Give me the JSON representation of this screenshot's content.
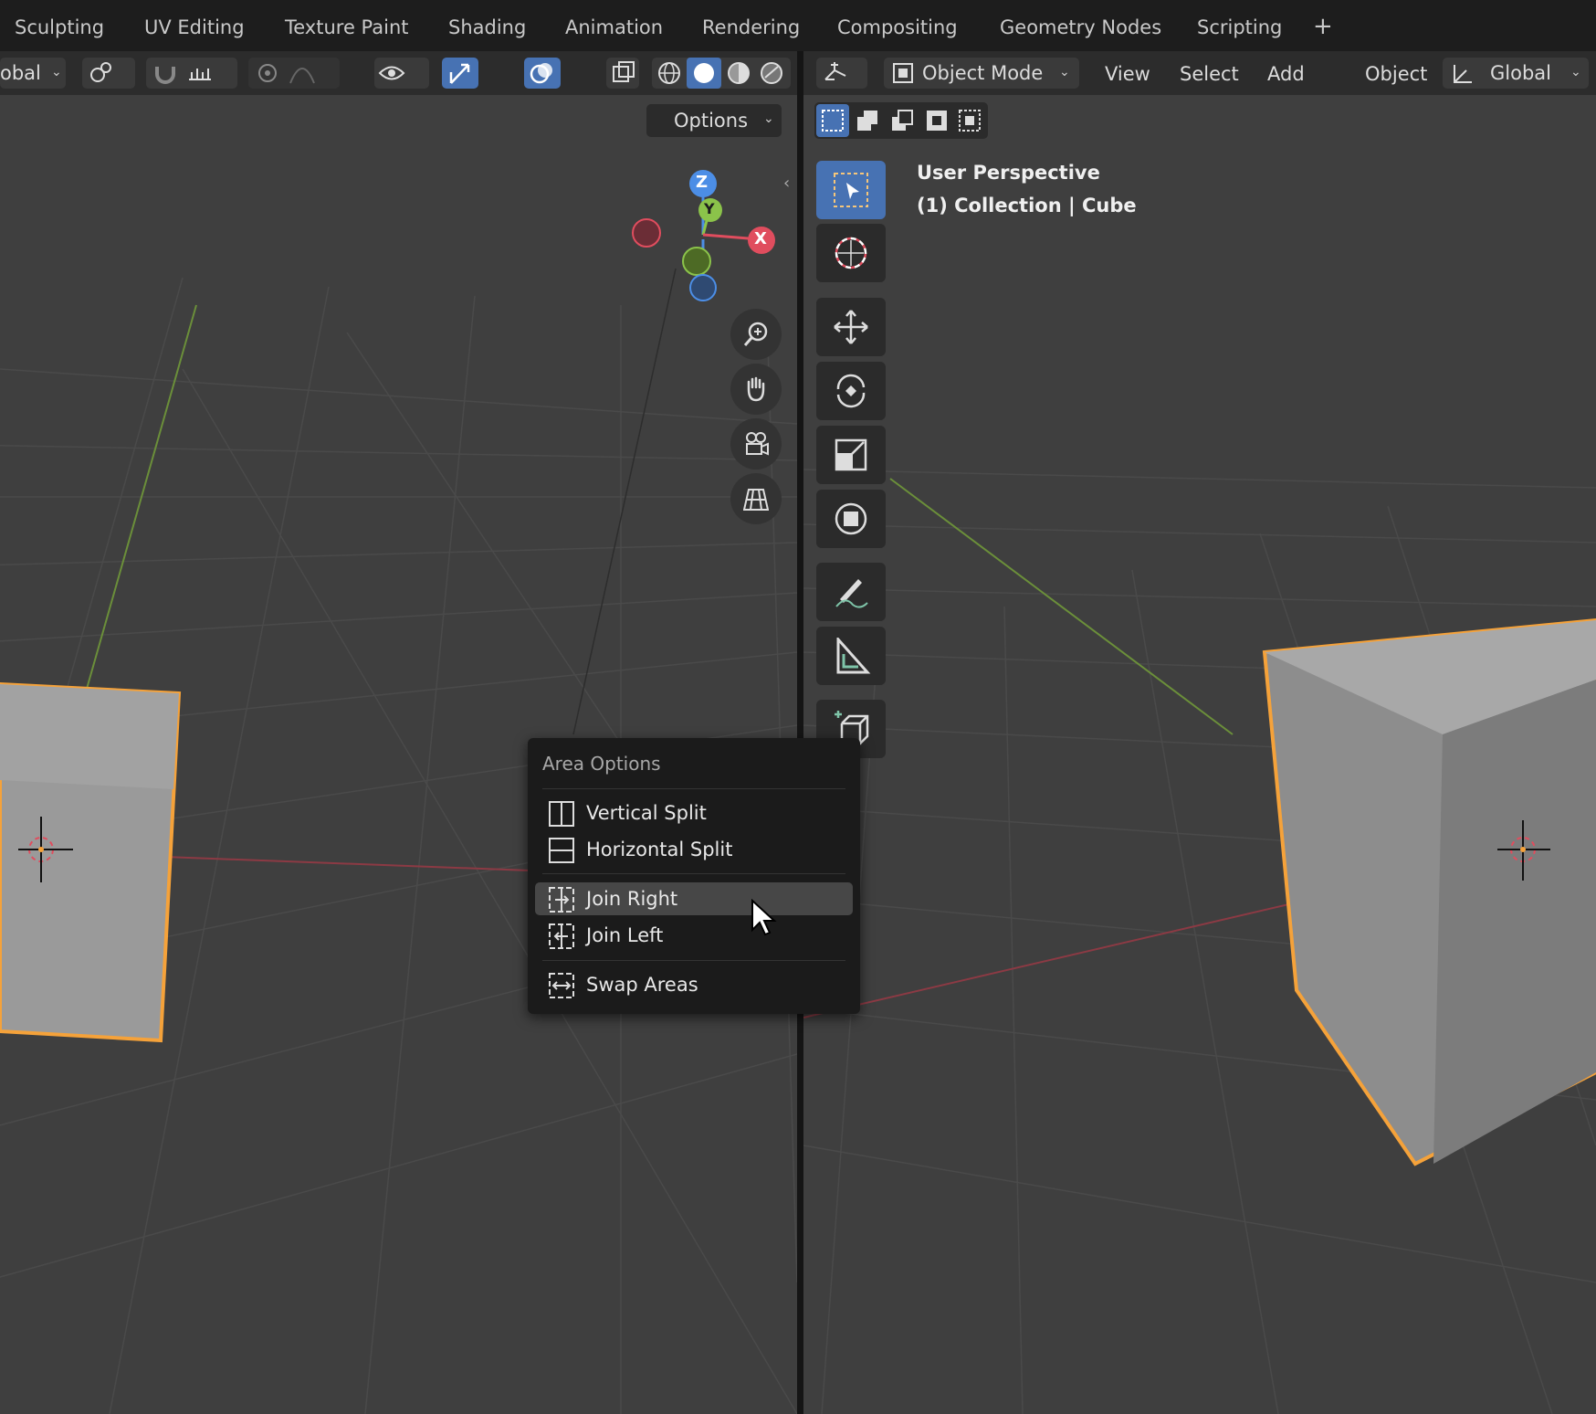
{
  "workspace_tabs": [
    "Sculpting",
    "UV Editing",
    "Texture Paint",
    "Shading",
    "Animation",
    "Rendering",
    "Compositing",
    "Geometry Nodes",
    "Scripting"
  ],
  "add_tab_symbol": "+",
  "left_header": {
    "orientation_partial": "obal",
    "options_label": "Options"
  },
  "right_header": {
    "mode_label": "Object Mode",
    "menus": [
      "View",
      "Select",
      "Add",
      "Object"
    ],
    "orientation_label": "Global"
  },
  "viewport_overlay": {
    "perspective": "User Perspective",
    "collection": "(1) Collection | Cube"
  },
  "gizmo": {
    "z": "Z",
    "y": "Y",
    "x": "X"
  },
  "popup": {
    "title": "Area Options",
    "items": [
      {
        "label": "Vertical Split",
        "icon": "vertical-split-icon"
      },
      {
        "label": "Horizontal Split",
        "icon": "horizontal-split-icon"
      },
      {
        "label": "Join Right",
        "icon": "join-right-icon",
        "highlighted": true
      },
      {
        "label": "Join Left",
        "icon": "join-left-icon"
      },
      {
        "label": "Swap Areas",
        "icon": "swap-areas-icon"
      }
    ]
  },
  "toolbar_tools": [
    "select-box-icon",
    "cursor-icon",
    "move-icon",
    "rotate-icon",
    "scale-icon",
    "transform-icon",
    "annotate-icon",
    "measure-icon",
    "add-cube-icon"
  ],
  "colors": {
    "accent": "#4772b3",
    "selection_outline": "#f5a23a",
    "x_axis": "#e04d5e",
    "y_axis": "#8bc34a",
    "z_axis": "#4c8ee6"
  }
}
